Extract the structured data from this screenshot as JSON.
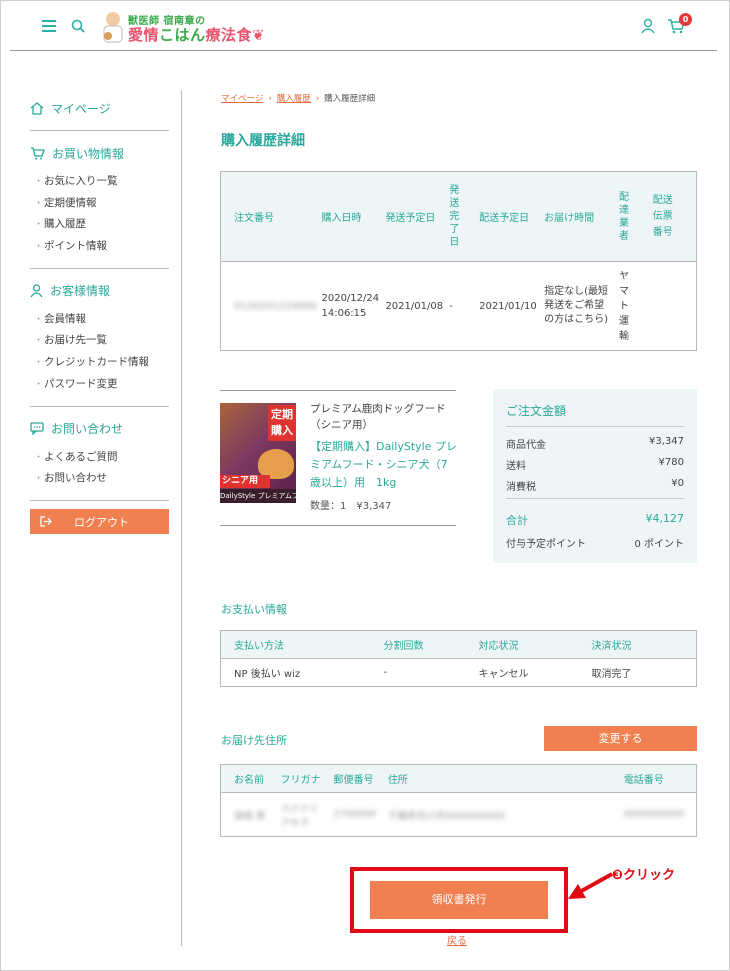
{
  "header": {
    "logo_top": "獣医師 宿南章の",
    "logo_main_a": "愛情",
    "logo_main_b": "こはん",
    "logo_main_c": "療法食",
    "cart_count": "0"
  },
  "sidebar": {
    "mypage": "マイページ",
    "shopping": {
      "title": "お買い物情報",
      "items": [
        "お気に入り一覧",
        "定期便情報",
        "購入履歴",
        "ポイント情報"
      ]
    },
    "customer": {
      "title": "お客様情報",
      "items": [
        "会員情報",
        "お届け先一覧",
        "クレジットカード情報",
        "パスワード変更"
      ]
    },
    "contact": {
      "title": "お問い合わせ",
      "items": [
        "よくあるご質問",
        "お問い合わせ"
      ]
    },
    "logout": "ログアウト"
  },
  "breadcrumb": [
    "マイページ",
    "購入履歴",
    "購入履歴詳細"
  ],
  "page_title": "購入履歴詳細",
  "order_table": {
    "headers": [
      "注文番号",
      "購入日時",
      "発送予定日",
      "発送完了日",
      "配送予定日",
      "お届け時間",
      "配達業者",
      "配送伝票番号"
    ],
    "row": {
      "order_no": "0120201224000",
      "purchase_date": "2020/12/24",
      "purchase_time": "14:06:15",
      "ship_plan": "2021/01/08",
      "ship_done": "-",
      "delivery_plan": "2021/01/10",
      "delivery_time": "指定なし(最短発送をご希望の方はこちら)",
      "carrier": "ヤマト運輸",
      "tracking": ""
    }
  },
  "product": {
    "image_tag1": "定期購入",
    "image_tag2": "シニア用",
    "image_tag3": "DailyStyle プレミアムフード",
    "name": "プレミアム鹿肉ドッグフード（シニア用）",
    "desc": "【定期購入】DailyStyle プレミアムフード・シニア犬（7歳以上）用　1kg",
    "qty": "数量：1　¥3,347"
  },
  "summary": {
    "title": "ご注文金額",
    "rows": [
      {
        "label": "商品代金",
        "value": "¥3,347"
      },
      {
        "label": "送料",
        "value": "¥780"
      },
      {
        "label": "消費税",
        "value": "¥0"
      }
    ],
    "total_label": "合計",
    "total_value": "¥4,127",
    "points_label": "付与予定ポイント",
    "points_value": "0 ポイント"
  },
  "payment": {
    "section_label": "お支払い情報",
    "headers": [
      "支払い方法",
      "分割回数",
      "対応状況",
      "決済状況"
    ],
    "row": [
      "NP 後払い wiz",
      "-",
      "キャンセル",
      "取消完了"
    ]
  },
  "address": {
    "section_label": "お届け先住所",
    "change_button": "変更する",
    "headers": [
      "お名前",
      "フリガナ",
      "郵便番号",
      "住所",
      "電話番号"
    ],
    "row": [
      "宿南 章",
      "スクナミ アキラ",
      "2700000",
      "千葉県市川市0000000000",
      "0000000000"
    ]
  },
  "receipt_button": "領収書発行",
  "back_link": "戻る",
  "annotation": "❸クリック",
  "colors": {
    "accent": "#2aa89b",
    "button": "#f08050",
    "highlight": "#e00a16"
  }
}
